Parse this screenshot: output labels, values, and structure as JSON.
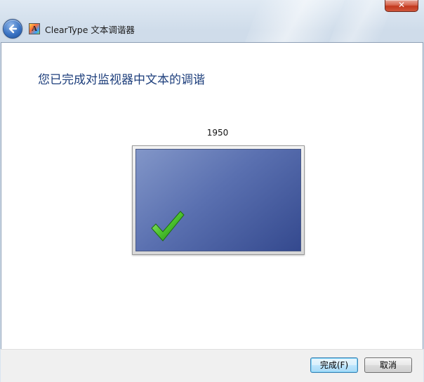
{
  "window": {
    "title": "ClearType 文本调谐器",
    "close_label": "✕"
  },
  "icons": {
    "back": "back-arrow-icon",
    "app": "cleartype-app-icon",
    "app_glyph": "A",
    "check": "checkmark-icon"
  },
  "main": {
    "heading": "您已完成对监视器中文本的调谐",
    "monitor_label": "1950"
  },
  "footer": {
    "finish_label": "完成(F)",
    "cancel_label": "取消"
  },
  "colors": {
    "heading": "#1e3f7c",
    "screen_start": "#8296c8",
    "screen_end": "#34498e",
    "check": "#3fae2a"
  }
}
